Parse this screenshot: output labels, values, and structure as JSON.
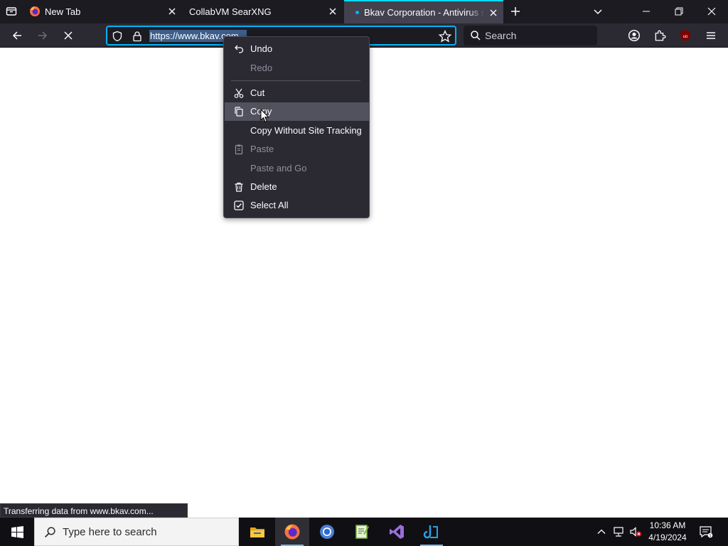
{
  "browser": {
    "tabs": [
      {
        "title": "New Tab",
        "icon": "firefox-icon"
      },
      {
        "title": "CollabVM SearXNG",
        "icon": "none"
      },
      {
        "title": "Bkav Corporation - Antivirus software",
        "icon": "loading-dot-icon",
        "active": true
      }
    ],
    "url": "https://www.bkav.com",
    "search_placeholder": "Search",
    "status": "Transferring data from www.bkav.com..."
  },
  "context_menu": {
    "items": [
      {
        "label": "Undo",
        "icon": "undo-icon",
        "enabled": true
      },
      {
        "label": "Redo",
        "icon": "redo-icon",
        "enabled": false
      },
      {
        "label": "Cut",
        "icon": "scissors-icon",
        "enabled": true
      },
      {
        "label": "Copy",
        "icon": "copy-icon",
        "enabled": true,
        "highlighted": true
      },
      {
        "label": "Copy Without Site Tracking",
        "icon": "none",
        "enabled": true
      },
      {
        "label": "Paste",
        "icon": "clipboard-icon",
        "enabled": false
      },
      {
        "label": "Paste and Go",
        "icon": "none",
        "enabled": false
      },
      {
        "label": "Delete",
        "icon": "trash-icon",
        "enabled": true
      },
      {
        "label": "Select All",
        "icon": "checkbox-icon",
        "enabled": true
      }
    ]
  },
  "taskbar": {
    "search_placeholder": "Type here to search",
    "apps": [
      "file-explorer-icon",
      "firefox-icon",
      "chrome-icon",
      "notepad-plus-plus-icon",
      "visual-studio-icon",
      "azure-data-studio-icon"
    ],
    "clock": {
      "time": "10:36 AM",
      "date": "4/19/2024"
    }
  },
  "colors": {
    "accent": "#00b3f4",
    "active_tab_line": "#00ddff",
    "toolbar": "#2b2a33",
    "tabstrip": "#1c1b22"
  }
}
